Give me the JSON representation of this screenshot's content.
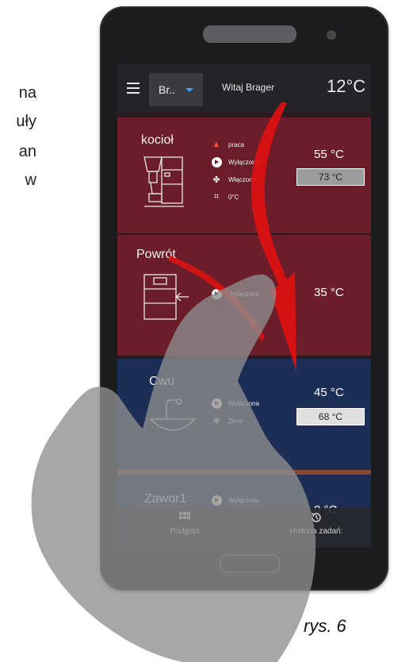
{
  "side_text": [
    "na",
    "uły",
    "an",
    "w"
  ],
  "header": {
    "module_select": "Br..",
    "welcome": "Witaj Brager",
    "outdoor_temp": "12°C"
  },
  "modules": {
    "kociol": {
      "title": "kocioł",
      "status": [
        "praca",
        "Wyłączona",
        "Włączona",
        "0°C"
      ],
      "temp": "55 °C",
      "set_temp": "73 °C"
    },
    "powrot": {
      "title": "Powrót",
      "status": [
        "Wyłączona"
      ],
      "temp": "35 °C"
    },
    "cwu": {
      "title": "Cwu",
      "status": [
        "Wyłączona",
        "Zima"
      ],
      "temp": "45 °C",
      "set_temp": "68 °C"
    },
    "zawor": {
      "title": "Zawor1",
      "status": [
        "Wyłączona"
      ],
      "temp": "0 °C"
    }
  },
  "nav": {
    "preview": "Podgląd",
    "history": "Historia zadań:"
  },
  "caption": "rys. 6",
  "colors": {
    "module_heating": "#6b1e2a",
    "module_water": "#1c2e56",
    "arrow": "#e01010",
    "hand": "#8e8e8e"
  }
}
